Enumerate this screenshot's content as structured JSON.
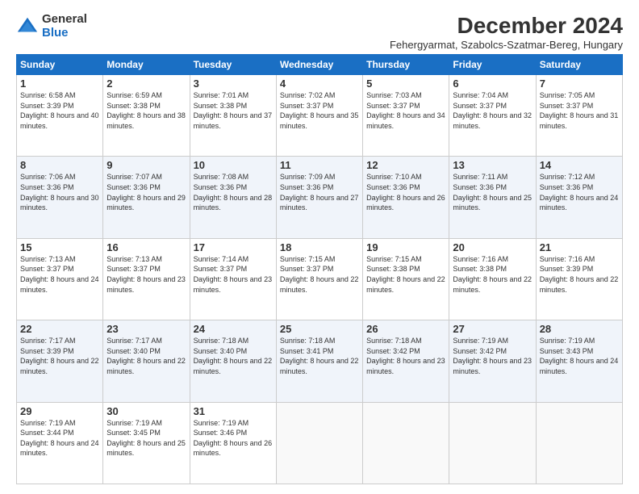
{
  "logo": {
    "general": "General",
    "blue": "Blue"
  },
  "title": "December 2024",
  "subtitle": "Fehergyarmat, Szabolcs-Szatmar-Bereg, Hungary",
  "headers": [
    "Sunday",
    "Monday",
    "Tuesday",
    "Wednesday",
    "Thursday",
    "Friday",
    "Saturday"
  ],
  "weeks": [
    [
      {
        "day": "1",
        "sunrise": "6:58 AM",
        "sunset": "3:39 PM",
        "daylight": "8 hours and 40 minutes."
      },
      {
        "day": "2",
        "sunrise": "6:59 AM",
        "sunset": "3:38 PM",
        "daylight": "8 hours and 38 minutes."
      },
      {
        "day": "3",
        "sunrise": "7:01 AM",
        "sunset": "3:38 PM",
        "daylight": "8 hours and 37 minutes."
      },
      {
        "day": "4",
        "sunrise": "7:02 AM",
        "sunset": "3:37 PM",
        "daylight": "8 hours and 35 minutes."
      },
      {
        "day": "5",
        "sunrise": "7:03 AM",
        "sunset": "3:37 PM",
        "daylight": "8 hours and 34 minutes."
      },
      {
        "day": "6",
        "sunrise": "7:04 AM",
        "sunset": "3:37 PM",
        "daylight": "8 hours and 32 minutes."
      },
      {
        "day": "7",
        "sunrise": "7:05 AM",
        "sunset": "3:37 PM",
        "daylight": "8 hours and 31 minutes."
      }
    ],
    [
      {
        "day": "8",
        "sunrise": "7:06 AM",
        "sunset": "3:36 PM",
        "daylight": "8 hours and 30 minutes."
      },
      {
        "day": "9",
        "sunrise": "7:07 AM",
        "sunset": "3:36 PM",
        "daylight": "8 hours and 29 minutes."
      },
      {
        "day": "10",
        "sunrise": "7:08 AM",
        "sunset": "3:36 PM",
        "daylight": "8 hours and 28 minutes."
      },
      {
        "day": "11",
        "sunrise": "7:09 AM",
        "sunset": "3:36 PM",
        "daylight": "8 hours and 27 minutes."
      },
      {
        "day": "12",
        "sunrise": "7:10 AM",
        "sunset": "3:36 PM",
        "daylight": "8 hours and 26 minutes."
      },
      {
        "day": "13",
        "sunrise": "7:11 AM",
        "sunset": "3:36 PM",
        "daylight": "8 hours and 25 minutes."
      },
      {
        "day": "14",
        "sunrise": "7:12 AM",
        "sunset": "3:36 PM",
        "daylight": "8 hours and 24 minutes."
      }
    ],
    [
      {
        "day": "15",
        "sunrise": "7:13 AM",
        "sunset": "3:37 PM",
        "daylight": "8 hours and 24 minutes."
      },
      {
        "day": "16",
        "sunrise": "7:13 AM",
        "sunset": "3:37 PM",
        "daylight": "8 hours and 23 minutes."
      },
      {
        "day": "17",
        "sunrise": "7:14 AM",
        "sunset": "3:37 PM",
        "daylight": "8 hours and 23 minutes."
      },
      {
        "day": "18",
        "sunrise": "7:15 AM",
        "sunset": "3:37 PM",
        "daylight": "8 hours and 22 minutes."
      },
      {
        "day": "19",
        "sunrise": "7:15 AM",
        "sunset": "3:38 PM",
        "daylight": "8 hours and 22 minutes."
      },
      {
        "day": "20",
        "sunrise": "7:16 AM",
        "sunset": "3:38 PM",
        "daylight": "8 hours and 22 minutes."
      },
      {
        "day": "21",
        "sunrise": "7:16 AM",
        "sunset": "3:39 PM",
        "daylight": "8 hours and 22 minutes."
      }
    ],
    [
      {
        "day": "22",
        "sunrise": "7:17 AM",
        "sunset": "3:39 PM",
        "daylight": "8 hours and 22 minutes."
      },
      {
        "day": "23",
        "sunrise": "7:17 AM",
        "sunset": "3:40 PM",
        "daylight": "8 hours and 22 minutes."
      },
      {
        "day": "24",
        "sunrise": "7:18 AM",
        "sunset": "3:40 PM",
        "daylight": "8 hours and 22 minutes."
      },
      {
        "day": "25",
        "sunrise": "7:18 AM",
        "sunset": "3:41 PM",
        "daylight": "8 hours and 22 minutes."
      },
      {
        "day": "26",
        "sunrise": "7:18 AM",
        "sunset": "3:42 PM",
        "daylight": "8 hours and 23 minutes."
      },
      {
        "day": "27",
        "sunrise": "7:19 AM",
        "sunset": "3:42 PM",
        "daylight": "8 hours and 23 minutes."
      },
      {
        "day": "28",
        "sunrise": "7:19 AM",
        "sunset": "3:43 PM",
        "daylight": "8 hours and 24 minutes."
      }
    ],
    [
      {
        "day": "29",
        "sunrise": "7:19 AM",
        "sunset": "3:44 PM",
        "daylight": "8 hours and 24 minutes."
      },
      {
        "day": "30",
        "sunrise": "7:19 AM",
        "sunset": "3:45 PM",
        "daylight": "8 hours and 25 minutes."
      },
      {
        "day": "31",
        "sunrise": "7:19 AM",
        "sunset": "3:46 PM",
        "daylight": "8 hours and 26 minutes."
      },
      null,
      null,
      null,
      null
    ]
  ]
}
